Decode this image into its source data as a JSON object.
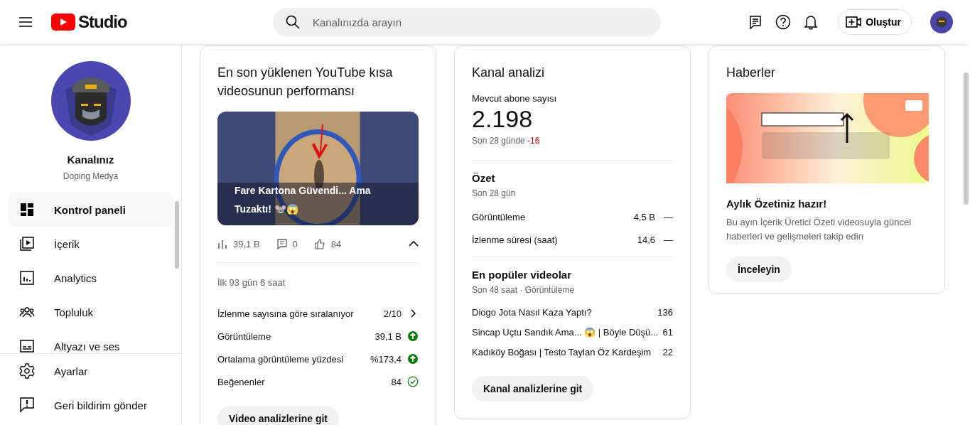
{
  "header": {
    "logo_text": "Studio",
    "search": {
      "placeholder": "Kanalınızda arayın"
    },
    "create_button": "Oluştur"
  },
  "sidebar": {
    "channel_label": "Kanalınız",
    "channel_name": "Doping Medya",
    "items": [
      {
        "label": "Kontrol paneli",
        "kind": "dashboard",
        "selected": true
      },
      {
        "label": "İçerik",
        "kind": "content",
        "selected": false
      },
      {
        "label": "Analytics",
        "kind": "analytics",
        "selected": false
      },
      {
        "label": "Topluluk",
        "kind": "community",
        "selected": false
      },
      {
        "label": "Altyazı ve ses",
        "kind": "subtitles",
        "selected": false
      }
    ],
    "bottom_items": [
      {
        "label": "Ayarlar",
        "kind": "settings"
      },
      {
        "label": "Geri bildirim gönder",
        "kind": "feedback"
      }
    ]
  },
  "short_card": {
    "title": "En son yüklenen YouTube kısa videosunun performansı",
    "video_title": "Fare Kartona Güvendi... Ama Tuzaktı! 🐭😱",
    "stats": [
      {
        "kind": "views",
        "value": "39,1 B"
      },
      {
        "kind": "comments",
        "value": "0"
      },
      {
        "kind": "likes",
        "value": "84"
      }
    ],
    "expanded": true,
    "period": "İlk 93 gün 6 saat",
    "metrics": [
      {
        "label": "İzlenme sayısına göre sıralanıyor",
        "value": "2/10",
        "kind": "chevron"
      },
      {
        "label": "Görüntüleme",
        "value": "39,1 B",
        "kind": "up"
      },
      {
        "label": "Ortalama görüntüleme yüzdesi",
        "value": "%173,4",
        "kind": "up"
      },
      {
        "label": "Beğenenler",
        "value": "84",
        "kind": "check"
      }
    ],
    "button": "Video analizlerine git"
  },
  "analytics_card": {
    "title": "Kanal analizi",
    "subscribers_label": "Mevcut abone sayısı",
    "subscribers": "2.198",
    "change_label": "Son 28 günde",
    "change": "-16",
    "summary_title": "Özet",
    "summary_period": "Son 28 gün",
    "summary_rows": [
      {
        "label": "Görüntüleme",
        "value": "4,5 B",
        "trend": "—"
      },
      {
        "label": "İzlenme süresi (saat)",
        "value": "14,6",
        "trend": "—"
      }
    ],
    "top_title": "En popüler videolar",
    "top_period": "Son 48 saat · Görüntüleme",
    "top_videos": [
      {
        "title": "Diogo Jota Nasıl Kaza Yaptı?",
        "views": "136"
      },
      {
        "title": "Sincap Uçtu Sandık Ama... 😱 | Böyle Düşü...",
        "views": "61"
      },
      {
        "title": "Kadıköy Boğası | Testo Taylan Öz Kardeşim",
        "views": "22"
      }
    ],
    "button": "Kanal analizlerine git"
  },
  "news_card": {
    "title": "Haberler",
    "headline": "Aylık Özetiniz hazır!",
    "text": "Bu ayın İçerik Üretici Özeti videosuyla güncel haberleri ve gelişmeleri takip edin",
    "button": "İnceleyin"
  }
}
